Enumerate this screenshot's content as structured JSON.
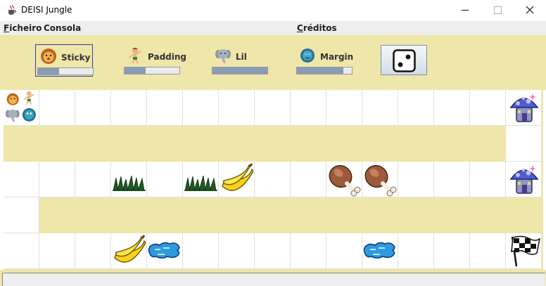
{
  "window": {
    "title": "DEISI Jungle"
  },
  "menu": {
    "file": {
      "first": "F",
      "rest": "icheiro"
    },
    "console": "Consola",
    "credits": {
      "first": "C",
      "rest": "réditos"
    }
  },
  "players": [
    {
      "name": "Sticky",
      "animal": "lion",
      "energy": 0.38,
      "selected": true
    },
    {
      "name": "Padding",
      "animal": "tarzan",
      "energy": 0.38,
      "selected": false
    },
    {
      "name": "Lil",
      "animal": "elephant",
      "energy": 1.0,
      "selected": false
    },
    {
      "name": "Margin",
      "animal": "turtle",
      "energy": 0.85,
      "selected": false
    }
  ],
  "dice": {
    "icon": "dice-two-icon"
  },
  "board": {
    "columns": 15,
    "row1_items": {
      "0": "players-stack",
      "14": "mushroom-house"
    },
    "row3_items": {
      "3": "grass",
      "5": "grass",
      "6": "bananas",
      "9": "meat",
      "10": "meat",
      "14": "mushroom-house"
    },
    "row5_items": {
      "3": "bananas",
      "4": "water",
      "10": "water",
      "14": "finish-flag"
    }
  },
  "colors": {
    "bar_bg": "#efe6a9",
    "selection_border": "#2f3fa8",
    "energy_fill": "#8a9bb5"
  },
  "status": ""
}
